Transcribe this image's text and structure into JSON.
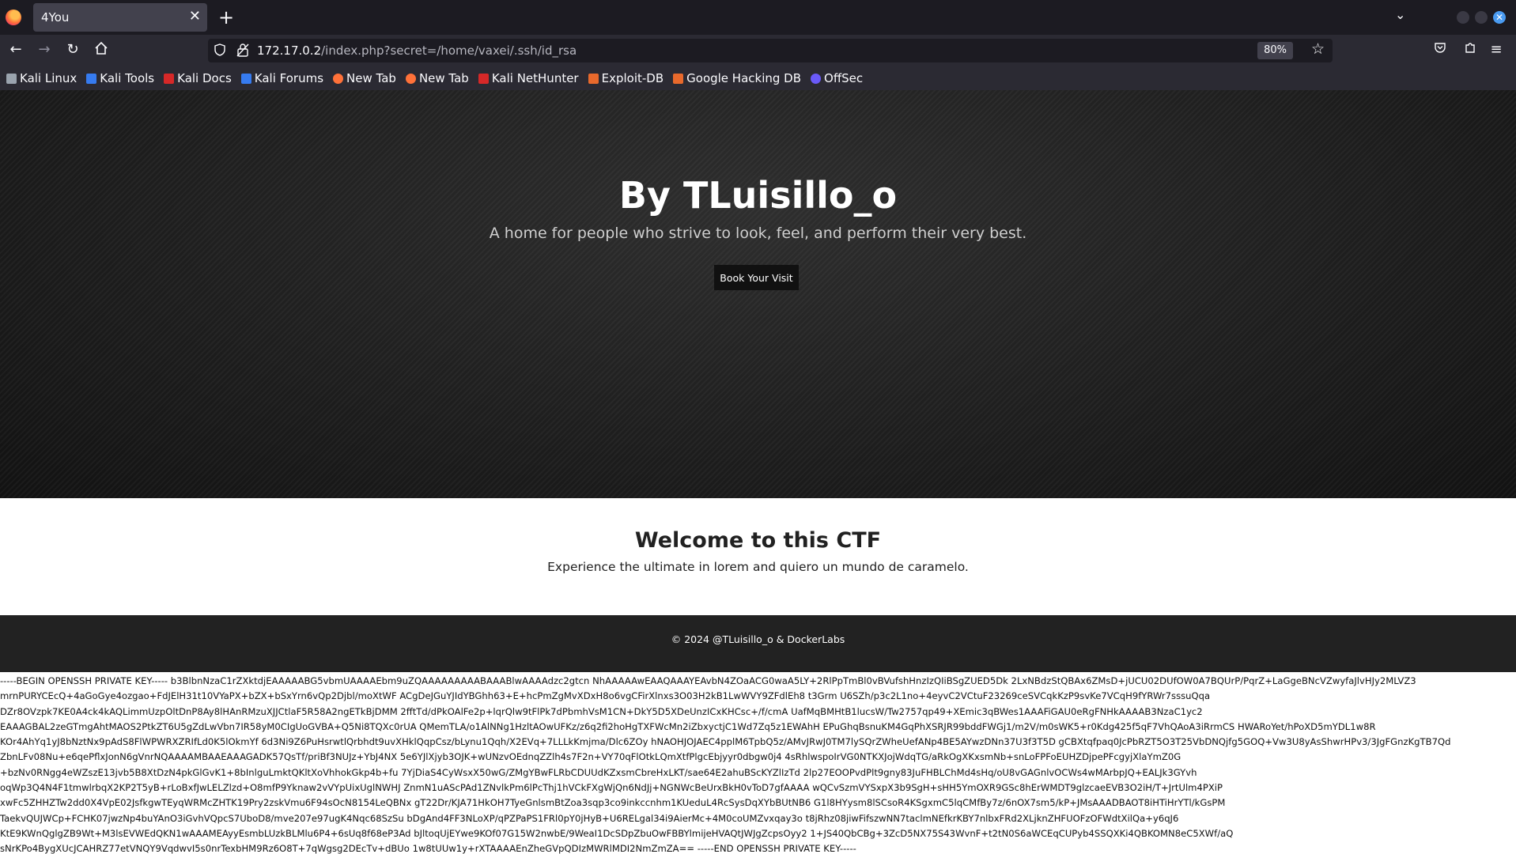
{
  "browser": {
    "tab_title": "4You",
    "url_host": "172.17.0.2",
    "url_path": "/index.php?secret=/home/vaxei/.ssh/id_rsa",
    "zoom": "80%",
    "bookmarks": [
      {
        "label": "Kali Linux",
        "icon": "kali-dragon-icon",
        "color": "#9aa3ae"
      },
      {
        "label": "Kali Tools",
        "icon": "kali-tools-icon",
        "color": "#367bf0"
      },
      {
        "label": "Kali Docs",
        "icon": "kali-docs-icon",
        "color": "#d62828"
      },
      {
        "label": "Kali Forums",
        "icon": "kali-forums-icon",
        "color": "#367bf0"
      },
      {
        "label": "New Tab",
        "icon": "firefox-icon",
        "color": "#ff7139"
      },
      {
        "label": "New Tab",
        "icon": "firefox-icon",
        "color": "#ff7139"
      },
      {
        "label": "Kali NetHunter",
        "icon": "nethunter-icon",
        "color": "#d62828"
      },
      {
        "label": "Exploit-DB",
        "icon": "exploit-db-icon",
        "color": "#e8692c"
      },
      {
        "label": "Google Hacking DB",
        "icon": "ghdb-icon",
        "color": "#e8692c"
      },
      {
        "label": "OffSec",
        "icon": "offsec-icon",
        "color": "#6a5af9"
      }
    ]
  },
  "hero": {
    "title": "By TLuisillo_o",
    "subtitle": "A home for people who strive to look, feel, and perform their very best.",
    "button": "Book Your Visit"
  },
  "welcome": {
    "title": "Welcome to this CTF",
    "text": "Experience the ultimate in lorem and quiero un mundo de caramelo."
  },
  "footer": {
    "text": "© 2024 @TLuisillo_o & DockerLabs"
  },
  "leaked_key_lines": [
    "-----BEGIN OPENSSH PRIVATE KEY----- b3BlbnNzaC1rZXktdjEAAAAABG5vbmUAAAAEbm9uZQAAAAAAAAABAAABlwAAAAdzc2gtcn NhAAAAAwEAAQAAAYEAvbN4ZOaACG0waA5LY+2RlPpTmBl0vBVufshHnzIzQIiBSgZUED5Dk 2LxNBdzStQBAx6ZMsD+jUCU02DUfOW0A7BQUrP/PqrZ+LaGgeBNcVZwyfaJlvHJy2MLVZ3",
    "mrnPURYCEcQ+4aGoGye4ozgao+FdJElH31t10VYaPX+bZX+bSxYrn6vQp2Djbl/moXtWF ACgDeJGuYJIdYBGhh63+E+hcPmZgMvXDxH8o6vgCFirXlnxs3O03H2kB1LwWVY9ZFdlEh8 t3Grm U6SZh/p3c2L1no+4eyvC2VCtuF23269ceSVCqkKzP9svKe7VCqH9fYRWr7sssuQqa",
    "DZr8OVzpk7KE0A4ck4kAQLimmUzpOltDnP8Ay8lHAnRMzuXJJCtlaF5R58A2ngETkBjDMM 2fftTd/dPkOAlFe2p+lqrQlw9tFlPk7dPbmhVsM1CN+DkY5D5XDeUnzICxKHCsc+/f/cmA UafMqBMHtB1lucsW/Tw2757qp49+XEmic3qBWes1AAAFiGAU0eRgFNHkAAAAB3NzaC1yc2",
    "EAAAGBAL2zeGTmgAhtMAOS2PtkZT6U5gZdLwVbn7IR58yM0CIgUoGVBA+Q5Ni8TQXc0rUA QMemTLA/o1AlNNg1HzltAOwUFKz/z6q2fi2hoHgTXFWcMn2iZbxyctjC1Wd7Zq5z1EWAhH EPuGhqBsnuKM4GqPhXSRJR99bddFWGj1/m2V/m0sWK5+r0Kdg425f5qF7VhQAoA3iRrmCS HWARoYet/hPoXD5mYDL1w8R",
    "KOr4AhYq1yJ8bNztNx9pAdS8FlWPWRXZRIfLd0K5lOkmYf 6d3Ni9Z6PuHsrwtlQrbhdt9uvXHklQqpCsz/bLynu1Qqh/X2EVq+7LLLkKmjma/Dlc6ZOy hNAOHJOJAEC4pplM6TpbQ5z/AMvJRwJ0TM7lySQrZWheUefANp4BE5AYwzDNn37U3f3T5D gCBXtqfpaq0JcPbRZT5O3T25VbDNQjfg5GOQ+Vw3U8yAsShwrHPv3/3JgFGnzKgTB7Qd",
    "ZbnLFv08Nu+e6qePflxJonN6gVnrNQAAAAMBAAEAAAGADK57QsTf/priBf3NUJz+YbJ4NX 5e6YJlXjyb3OJK+wUNzvOEdnqZZlh4s7F2n+VY70qFlOtkLQmXtfPlgcEbjyyr0dbgw0j4 4sRhlwspoIrVG0NTKXJojWdqTG/aRkOgXKxsmNb+snLoFPFoEUHZDjpePFcgyjXlaYmZ0G",
    "+bzNv0RNgg4eWZszE13jvb5B8XtDzN4pkGlGvK1+8bInlguLmktQKltXoVhhokGkp4b+fu 7YjDiaS4CyWsxX50wG/ZMgYBwFLRbCDUUdKZxsmCbreHxLKT/sae64E2ahuBScKYZlIzTd 2lp27EOOPvdPlt9gny83JuFHBLChMd4sHq/oU8vGAGnlvOCWs4wMArbpJQ+EALJk3GYvh",
    "oqWp3Q4N4F1tmwlrbqX2KP2T5yB+rLoBxfJwLELZlzd+O8mfP9Yknaw2vVYpUixUglNWHJ ZnmN1uAScPAd1ZNvlkPm6lPcThj1hVCkFXgWjQn6NdJj+NGNWcBeUrxBkH0vToD7gfAAAA wQCvSzmVYSxpX3b9SgH+sHH5YmOXR9GSc8hErWMDT9glzcaeEVB3O2iH/T+JrtUlm4PXiP",
    "xwFc5ZHHZTw2dd0X4VpE02JsfkgwTEyqWRMcZHTK19Pry2zskVmu6F94sOcN8154LeQBNx gT22Dr/KJA71HkOH7TyeGnlsmBtZoa3sqp3co9inkccnhm1KUeduL4RcSysDqXYbBUtNB6 G1l8HYysm8lSCsoR4KSgxmC5lqCMfBy7z/6nOX7sm5/kP+JMsAAADBAOT8iHTiHrYTl/kGsPM",
    "TaekvQUJWCp+FCHK07jwzNp4buYAnO3iGvhVQpcS7UboD8/mve207e97ugK4Nqc68SzSu bDgAnd4FF3NLoXP/qPZPaPS1FRl0pY0jHyB+U6RELgal34i9AierMc+4M0coUMZvxqay3o t8jRhz08jiwFifszwNN7taclmNEfkrKBY7nlbxFRd2XLjknZHFUOFzOFWdtXilQa+y6qJ6",
    "KtE9KWnQglgZB9Wt+M3lsEVWEdQKN1wAAAMEAyyEsmbLUzkBLMlu6P4+6sUq8f68eP3Ad bJltoqUjEYwe9KOf07G15W2nwbE/9WeaI1DcSDpZbuOwFBBYlmijeHVAQtJWJgZcpsOyy2 1+JS40QbCBg+3ZcD5NX75S43WvnF+t2tN0S6aWCEqCUPyb4SSQXKi4QBKOMN8eC5XWf/aQ",
    "sNrKPo4BygXUcJCAHRZ77etVNQY9VqdwvI5s0nrTexbHM9Rz6O8T+7qWgsg2DEcTv+dBUo 1w8tUUw1y+rXTAAAAEnZheGVpQDIzMWRlMDI2NmZmZA== -----END OPENSSH PRIVATE KEY-----"
  ]
}
